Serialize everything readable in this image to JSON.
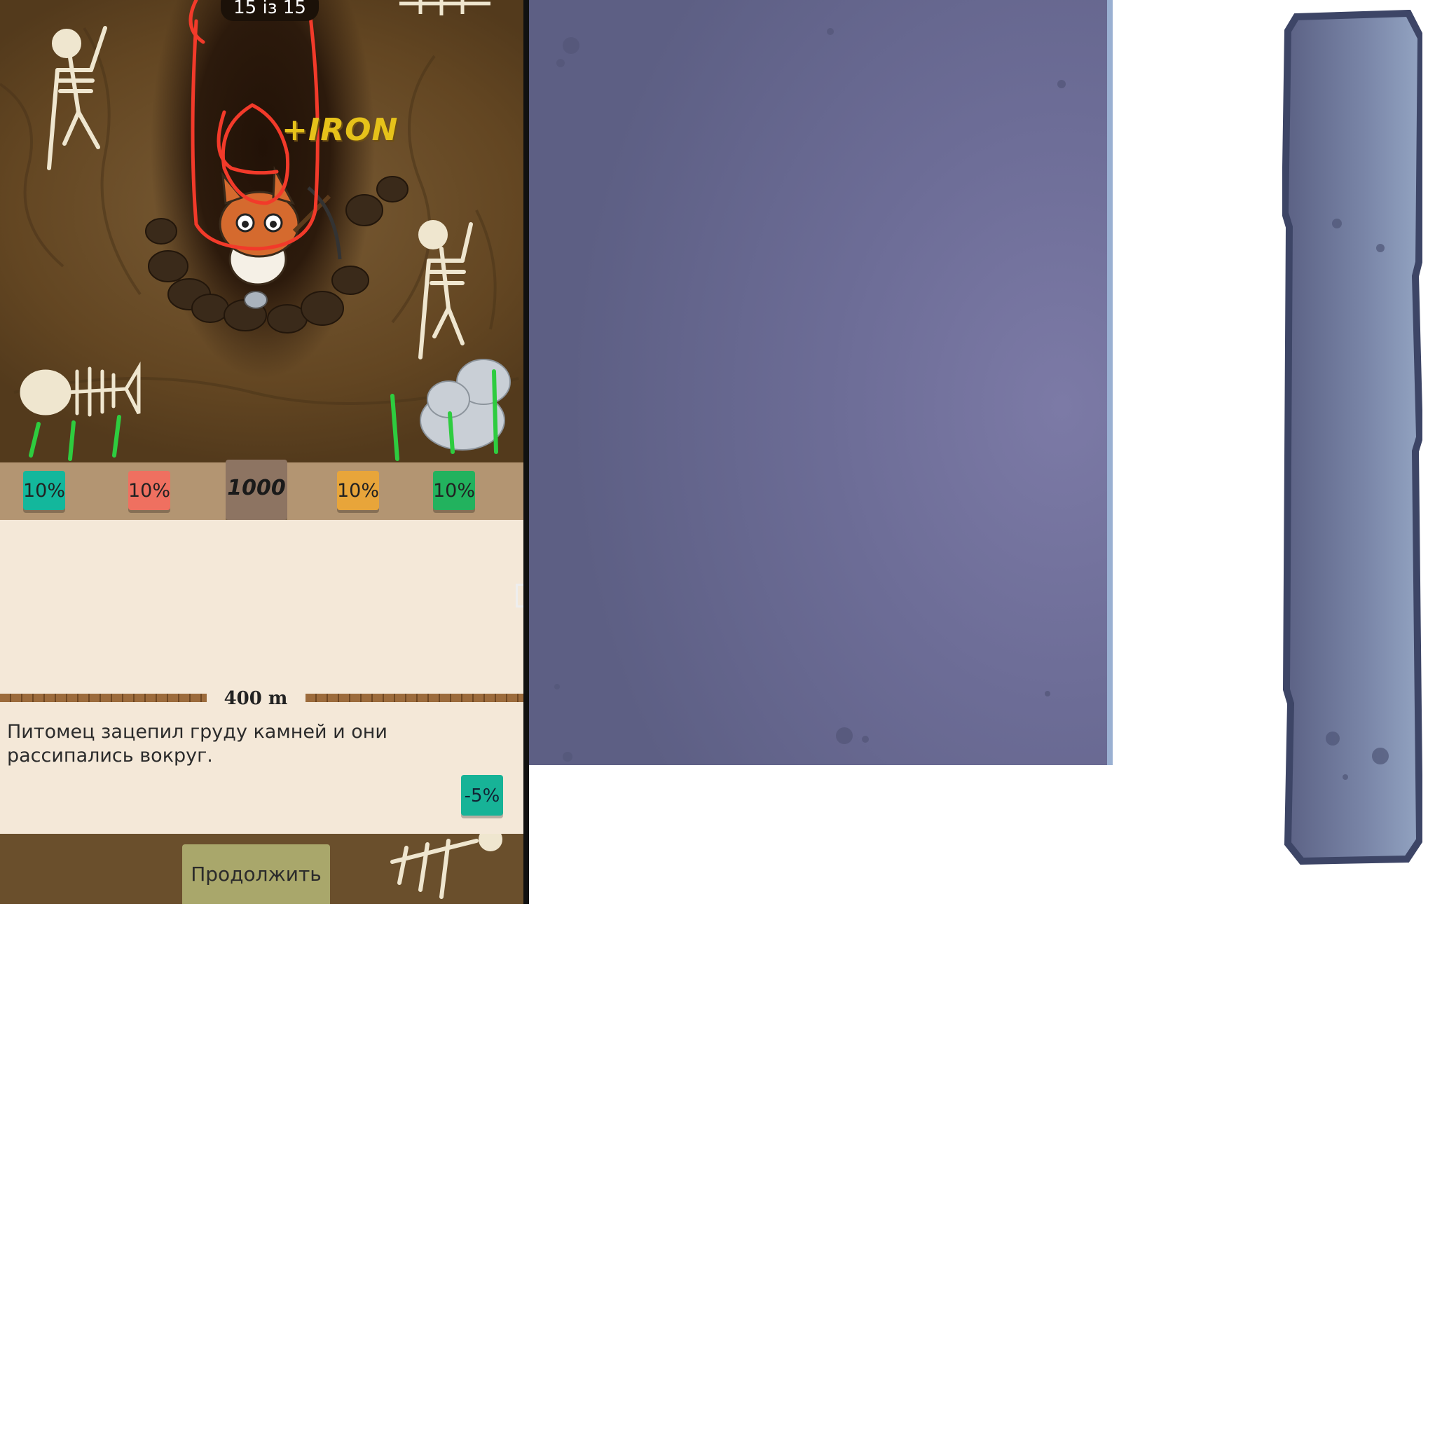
{
  "hud": {
    "counter": "15 із 15",
    "reward_popup": "+IRON"
  },
  "bonuses": [
    {
      "label": "10%",
      "color": "#13b79c"
    },
    {
      "label": "10%",
      "color": "#ef7060"
    },
    {
      "label": "10%",
      "color": "#e8a53a"
    },
    {
      "label": "10%",
      "color": "#22b25e"
    }
  ],
  "center_value": "1000",
  "depth": "400 m",
  "event": {
    "message": "Питомец зацепил груду камней и они рассипались вокруг.",
    "penalty": "-5%"
  },
  "continue_label": "Продолжить",
  "colors": {
    "annotation_red": "#f23a2a",
    "annotation_green": "#2ecc3f",
    "texture_blue": "#6d6d97"
  }
}
